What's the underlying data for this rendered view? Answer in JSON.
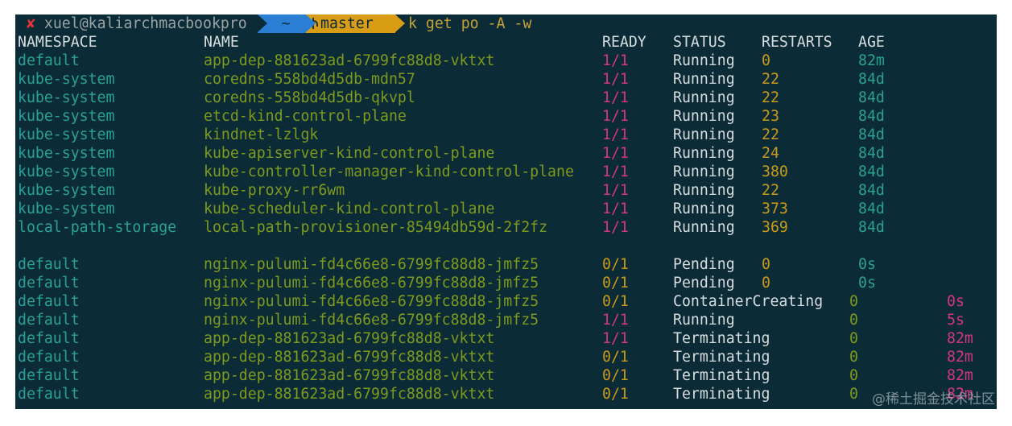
{
  "prompt": {
    "status_mark": "✘",
    "user_host": "xuel@kaliarchmacbookpro",
    "directory": "~",
    "git_branch_icon": "git-branch-icon",
    "git_branch": "master",
    "command": "k get po -A -w"
  },
  "table": {
    "headers": {
      "namespace": "NAMESPACE",
      "name": "NAME",
      "ready": "READY",
      "status": "STATUS",
      "restarts": "RESTARTS",
      "age": "AGE"
    },
    "rows": [
      {
        "namespace": "default",
        "name": "app-dep-881623ad-6799fc88d8-vktxt",
        "ready": "1/1",
        "status": "Running",
        "restarts": "0",
        "age": "82m"
      },
      {
        "namespace": "kube-system",
        "name": "coredns-558bd4d5db-mdn57",
        "ready": "1/1",
        "status": "Running",
        "restarts": "22",
        "age": "84d"
      },
      {
        "namespace": "kube-system",
        "name": "coredns-558bd4d5db-qkvpl",
        "ready": "1/1",
        "status": "Running",
        "restarts": "22",
        "age": "84d"
      },
      {
        "namespace": "kube-system",
        "name": "etcd-kind-control-plane",
        "ready": "1/1",
        "status": "Running",
        "restarts": "23",
        "age": "84d"
      },
      {
        "namespace": "kube-system",
        "name": "kindnet-lzlgk",
        "ready": "1/1",
        "status": "Running",
        "restarts": "22",
        "age": "84d"
      },
      {
        "namespace": "kube-system",
        "name": "kube-apiserver-kind-control-plane",
        "ready": "1/1",
        "status": "Running",
        "restarts": "24",
        "age": "84d"
      },
      {
        "namespace": "kube-system",
        "name": "kube-controller-manager-kind-control-plane",
        "ready": "1/1",
        "status": "Running",
        "restarts": "380",
        "age": "84d"
      },
      {
        "namespace": "kube-system",
        "name": "kube-proxy-rr6wm",
        "ready": "1/1",
        "status": "Running",
        "restarts": "22",
        "age": "84d"
      },
      {
        "namespace": "kube-system",
        "name": "kube-scheduler-kind-control-plane",
        "ready": "1/1",
        "status": "Running",
        "restarts": "373",
        "age": "84d"
      },
      {
        "namespace": "local-path-storage",
        "name": "local-path-provisioner-85494db59d-2f2fz",
        "ready": "1/1",
        "status": "Running",
        "restarts": "369",
        "age": "84d"
      }
    ],
    "watch_rows": [
      {
        "namespace": "default",
        "name": "nginx-pulumi-fd4c66e8-6799fc88d8-jmfz5",
        "ready": "0/1",
        "status": "Pending",
        "restarts": "0",
        "age": "0s"
      },
      {
        "namespace": "default",
        "name": "nginx-pulumi-fd4c66e8-6799fc88d8-jmfz5",
        "ready": "0/1",
        "status": "Pending",
        "restarts": "0",
        "age": "0s"
      },
      {
        "namespace": "default",
        "name": "nginx-pulumi-fd4c66e8-6799fc88d8-jmfz5",
        "ready": "0/1",
        "status": "ContainerCreating",
        "restarts": "0",
        "age": "0s"
      },
      {
        "namespace": "default",
        "name": "nginx-pulumi-fd4c66e8-6799fc88d8-jmfz5",
        "ready": "1/1",
        "status": "Running",
        "restarts": "0",
        "age": "5s"
      },
      {
        "namespace": "default",
        "name": "app-dep-881623ad-6799fc88d8-vktxt",
        "ready": "1/1",
        "status": "Terminating",
        "restarts": "0",
        "age": "82m"
      },
      {
        "namespace": "default",
        "name": "app-dep-881623ad-6799fc88d8-vktxt",
        "ready": "0/1",
        "status": "Terminating",
        "restarts": "0",
        "age": "82m"
      },
      {
        "namespace": "default",
        "name": "app-dep-881623ad-6799fc88d8-vktxt",
        "ready": "0/1",
        "status": "Terminating",
        "restarts": "0",
        "age": "82m"
      },
      {
        "namespace": "default",
        "name": "app-dep-881623ad-6799fc88d8-vktxt",
        "ready": "0/1",
        "status": "Terminating",
        "restarts": "0",
        "age": "82m"
      }
    ]
  },
  "watermark": "@稀土掘金技术社区",
  "colors": {
    "background": "#0b2b36",
    "namespace": "#2aa198",
    "name": "#7f9a1e",
    "ready_pink": "#d33682",
    "ready_yellow": "#c99a1a",
    "restarts": "#c99a1a",
    "dir_segment": "#2a7fd4",
    "git_segment": "#d99c15",
    "error_mark": "#e0353d"
  }
}
